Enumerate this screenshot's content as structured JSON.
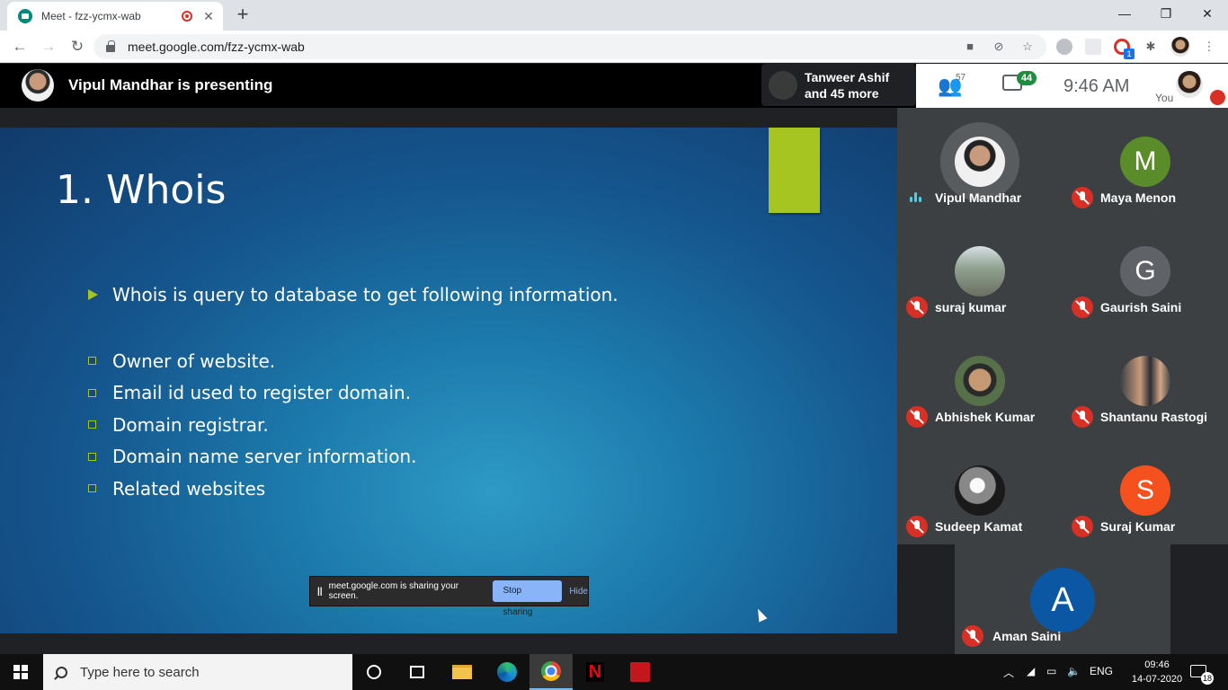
{
  "browser": {
    "tab_title": "Meet - fzz-ycmx-wab",
    "tab_close": "✕",
    "new_tab": "+",
    "url": "meet.google.com/fzz-ycmx-wab",
    "window": {
      "minimize": "—",
      "maximize": "❐",
      "close": "✕"
    },
    "extension_badge": "1"
  },
  "meet": {
    "presenting_text": "Vipul Mandhar is presenting",
    "pinned_tile": {
      "line1": "Tanweer Ashif",
      "line2": "and 45 more"
    },
    "people_count": "57",
    "chat_count": "44",
    "time": "9:46 AM",
    "you_label": "You"
  },
  "slide": {
    "title": "1. Whois",
    "main_bullet": "Whois is query to database to get following information.",
    "sub_bullets": [
      "Owner of website.",
      "Email id used to register domain.",
      "Domain registrar.",
      "Domain name server information.",
      "Related websites"
    ],
    "accent_color": "#a7c520"
  },
  "share_bar": {
    "pause": "||",
    "text": "meet.google.com is sharing your screen.",
    "stop_label": "Stop sharing",
    "hide_label": "Hide"
  },
  "participants": [
    {
      "name": "Vipul Mandhar",
      "status": "speaking"
    },
    {
      "name": "Maya Menon",
      "initial": "M",
      "color": "#5b8c2a",
      "status": "muted"
    },
    {
      "name": "suraj kumar",
      "status": "muted"
    },
    {
      "name": "Gaurish Saini",
      "initial": "G",
      "color": "#5f6368",
      "status": "muted"
    },
    {
      "name": "Abhishek Kumar",
      "status": "muted"
    },
    {
      "name": "Shantanu Rastogi",
      "status": "muted"
    },
    {
      "name": "Sudeep Kamat",
      "status": "muted"
    },
    {
      "name": "Suraj Kumar",
      "initial": "S",
      "color": "#f4511e",
      "status": "muted"
    },
    {
      "name": "Aman Saini",
      "initial": "A",
      "color": "#0b57a4",
      "status": "muted"
    }
  ],
  "taskbar": {
    "search_placeholder": "Type here to search",
    "language": "ENG",
    "time": "09:46",
    "date": "14-07-2020",
    "notification_count": "18"
  }
}
